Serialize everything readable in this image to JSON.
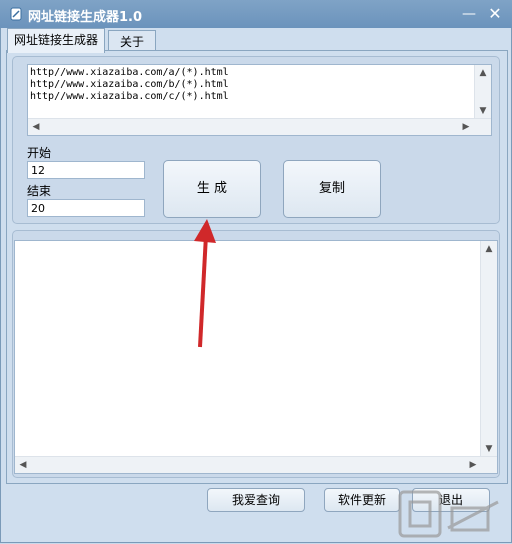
{
  "window": {
    "title": "网址链接生成器1.0",
    "minimize_glyph": "—",
    "close_glyph": "✕"
  },
  "tabs": [
    {
      "label": "网址链接生成器"
    },
    {
      "label": "关于"
    }
  ],
  "template_lines": [
    "http//www.xiazaiba.com/a/(*).html",
    "http//www.xiazaiba.com/b/(*).html",
    "http//www.xiazaiba.com/c/(*).html"
  ],
  "start": {
    "label": "开始",
    "value": "12"
  },
  "end": {
    "label": "结束",
    "value": "20"
  },
  "buttons": {
    "generate": "生 成",
    "copy": "复制"
  },
  "bottom_buttons": {
    "query": "我爱查询",
    "update": "软件更新",
    "exit": "退出"
  },
  "icons": {
    "title": "pencil-icon",
    "arrow": "red-arrow-annotation",
    "watermark": "watermark-logo"
  },
  "colors": {
    "titlebar": "#7a9fc3",
    "arrow": "#d0282a",
    "panel": "#cfdeee"
  }
}
